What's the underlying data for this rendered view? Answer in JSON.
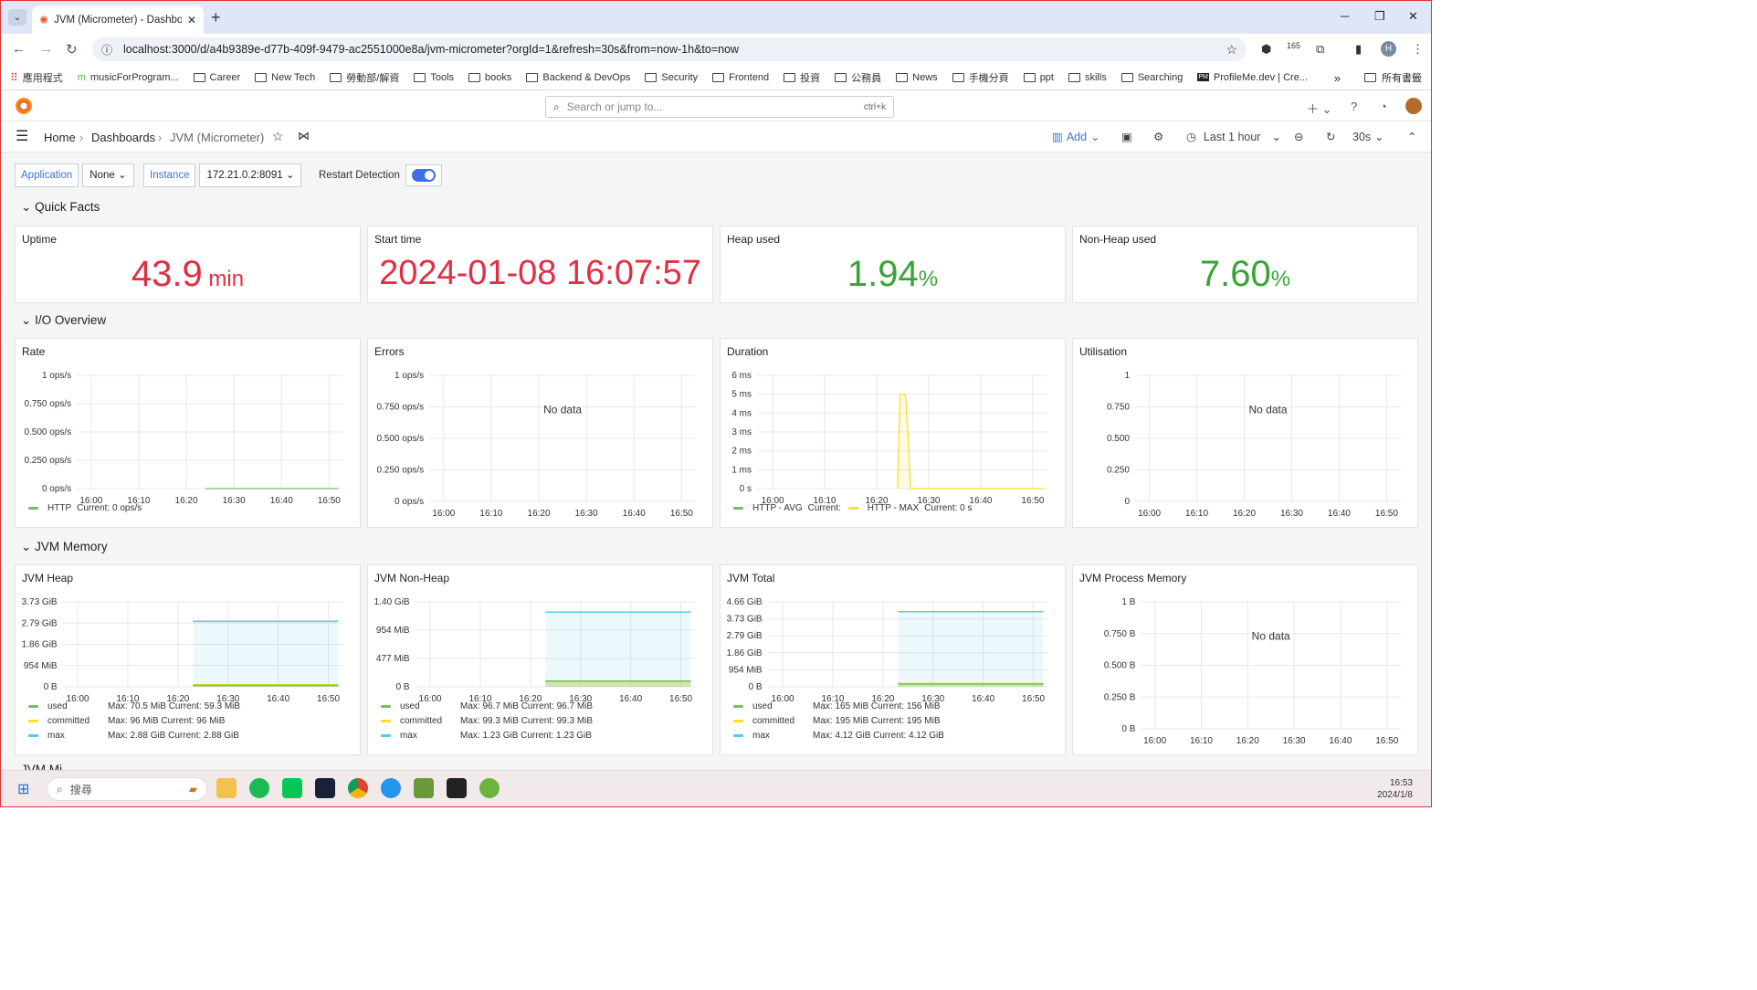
{
  "browser": {
    "tab_title": "JVM (Micrometer) - Dashboard",
    "url": "localhost:3000/d/a4b9389e-d77b-409f-9479-ac2551000e8a/jvm-micrometer?orgId=1&refresh=30s&from=now-1h&to=now",
    "ext_badge": "165",
    "profile_initial": "H",
    "bookmarks": [
      "應用程式",
      "musicForProgram...",
      "Career",
      "New Tech",
      "勞動部/解資",
      "Tools",
      "books",
      "Backend & DevOps",
      "Security",
      "Frontend",
      "投資",
      "公務員",
      "News",
      "手機分頁",
      "ppt",
      "skills",
      "Searching",
      "ProfileMe.dev | Cre..."
    ],
    "bookmarks_more": "»",
    "all_bookmarks": "所有書籤"
  },
  "grafana": {
    "search_placeholder": "Search or jump to...",
    "search_shortcut": "ctrl+k",
    "breadcrumb": [
      "Home",
      "Dashboards",
      "JVM (Micrometer)"
    ],
    "add_label": "Add",
    "time_range": "Last 1 hour",
    "refresh": "30s"
  },
  "variables": {
    "application_label": "Application",
    "application_value": "None",
    "instance_label": "Instance",
    "instance_value": "172.21.0.2:8091",
    "restart_label": "Restart Detection"
  },
  "rows": {
    "quick": "Quick Facts",
    "io": "I/O Overview",
    "mem": "JVM Memory",
    "next": "JVM Mi..."
  },
  "stats": [
    {
      "title": "Uptime",
      "value": "43.9",
      "unit": "min",
      "color": "#e02f44"
    },
    {
      "title": "Start time",
      "value": "2024-01-08 16:07:57",
      "unit": "",
      "color": "#e02f44"
    },
    {
      "title": "Heap used",
      "value": "1.94",
      "unit": "%",
      "color": "#37a535"
    },
    {
      "title": "Non-Heap used",
      "value": "7.60",
      "unit": "%",
      "color": "#37a535"
    }
  ],
  "x_ticks": [
    "16:00",
    "16:10",
    "16:20",
    "16:30",
    "16:40",
    "16:50"
  ],
  "no_data": "No data",
  "colors": {
    "green": "#73bf69",
    "yellow": "#fade2a",
    "blue": "#8ab8ff",
    "cyan": "#5fc6e3",
    "red": "#e02f44",
    "stat_green": "#37a535"
  },
  "chart_data": [
    {
      "type": "line",
      "title": "Rate",
      "y_ticks": [
        "1 ops/s",
        "0.750 ops/s",
        "0.500 ops/s",
        "0.250 ops/s",
        "0 ops/s"
      ],
      "ylim": [
        0,
        1
      ],
      "series": [
        {
          "name": "HTTP",
          "color": "#73bf69",
          "x": [
            "16:24",
            "16:52"
          ],
          "values": [
            0,
            0
          ]
        }
      ],
      "legend": [
        {
          "name": "HTTP",
          "text": "Current: 0 ops/s",
          "color": "#73bf69"
        }
      ]
    },
    {
      "type": "line",
      "title": "Errors",
      "y_ticks": [
        "1 ops/s",
        "0.750 ops/s",
        "0.500 ops/s",
        "0.250 ops/s",
        "0 ops/s"
      ],
      "ylim": [
        0,
        1
      ],
      "no_data": true,
      "series": []
    },
    {
      "type": "line",
      "title": "Duration",
      "y_ticks": [
        "6 ms",
        "5 ms",
        "4 ms",
        "3 ms",
        "2 ms",
        "1 ms",
        "0 s"
      ],
      "ylim": [
        0,
        6
      ],
      "series": [
        {
          "name": "HTTP - MAX",
          "color": "#fade2a",
          "points": [
            [
              "16:24",
              0
            ],
            [
              "16:24.5",
              5
            ],
            [
              "16:25.5",
              5
            ],
            [
              "16:26",
              3
            ],
            [
              "16:26.5",
              0
            ],
            [
              "16:52",
              0
            ]
          ]
        }
      ],
      "legend": [
        {
          "name": "HTTP - AVG",
          "text": "Current:",
          "color": "#73bf69"
        },
        {
          "name": "HTTP - MAX",
          "text": "Current: 0 s",
          "color": "#fade2a"
        }
      ]
    },
    {
      "type": "line",
      "title": "Utilisation",
      "y_ticks": [
        "1",
        "0.750",
        "0.500",
        "0.250",
        "0"
      ],
      "ylim": [
        0,
        1
      ],
      "no_data": true,
      "series": []
    },
    {
      "type": "area",
      "title": "JVM Heap",
      "y_ticks": [
        "3.73 GiB",
        "2.79 GiB",
        "1.86 GiB",
        "954 MiB",
        "0 B"
      ],
      "ylim_gib": [
        0,
        3.73
      ],
      "series": [
        {
          "name": "max",
          "color": "#5fc6e3",
          "values_gib": [
            2.88
          ]
        },
        {
          "name": "committed",
          "color": "#fade2a",
          "values_gib": [
            0.094
          ]
        },
        {
          "name": "used",
          "color": "#73bf69",
          "values_gib": [
            0.058
          ]
        }
      ],
      "legend": [
        {
          "name": "used",
          "text": "Max: 70.5 MiB  Current: 59.3 MiB",
          "color": "#73bf69"
        },
        {
          "name": "committed",
          "text": "Max: 96 MiB  Current: 96 MiB",
          "color": "#fade2a"
        },
        {
          "name": "max",
          "text": "Max: 2.88 GiB  Current: 2.88 GiB",
          "color": "#5fc6e3"
        }
      ]
    },
    {
      "type": "area",
      "title": "JVM Non-Heap",
      "y_ticks": [
        "1.40 GiB",
        "954 MiB",
        "477 MiB",
        "0 B"
      ],
      "ylim_gib": [
        0,
        1.4
      ],
      "series": [
        {
          "name": "max",
          "color": "#5fc6e3",
          "values_gib": [
            1.23
          ]
        },
        {
          "name": "committed",
          "color": "#fade2a",
          "values_gib": [
            0.097
          ]
        },
        {
          "name": "used",
          "color": "#73bf69",
          "values_gib": [
            0.094
          ]
        }
      ],
      "legend": [
        {
          "name": "used",
          "text": "Max: 96.7 MiB  Current: 96.7 MiB",
          "color": "#73bf69"
        },
        {
          "name": "committed",
          "text": "Max: 99.3 MiB  Current: 99.3 MiB",
          "color": "#fade2a"
        },
        {
          "name": "max",
          "text": "Max: 1.23 GiB  Current: 1.23 GiB",
          "color": "#5fc6e3"
        }
      ]
    },
    {
      "type": "area",
      "title": "JVM Total",
      "y_ticks": [
        "4.66 GiB",
        "3.73 GiB",
        "2.79 GiB",
        "1.86 GiB",
        "954 MiB",
        "0 B"
      ],
      "ylim_gib": [
        0,
        4.66
      ],
      "series": [
        {
          "name": "max",
          "color": "#5fc6e3",
          "values_gib": [
            4.12
          ]
        },
        {
          "name": "committed",
          "color": "#fade2a",
          "values_gib": [
            0.19
          ]
        },
        {
          "name": "used",
          "color": "#73bf69",
          "values_gib": [
            0.152
          ]
        }
      ],
      "legend": [
        {
          "name": "used",
          "text": "Max: 165 MiB  Current: 156 MiB",
          "color": "#73bf69"
        },
        {
          "name": "committed",
          "text": "Max: 195 MiB  Current: 195 MiB",
          "color": "#fade2a"
        },
        {
          "name": "max",
          "text": "Max: 4.12 GiB  Current: 4.12 GiB",
          "color": "#5fc6e3"
        }
      ]
    },
    {
      "type": "line",
      "title": "JVM Process Memory",
      "y_ticks": [
        "1 B",
        "0.750 B",
        "0.500 B",
        "0.250 B",
        "0 B"
      ],
      "ylim": [
        0,
        1
      ],
      "no_data": true,
      "series": []
    }
  ],
  "taskbar": {
    "search": "搜尋",
    "time": "16:53",
    "date": "2024/1/8"
  }
}
